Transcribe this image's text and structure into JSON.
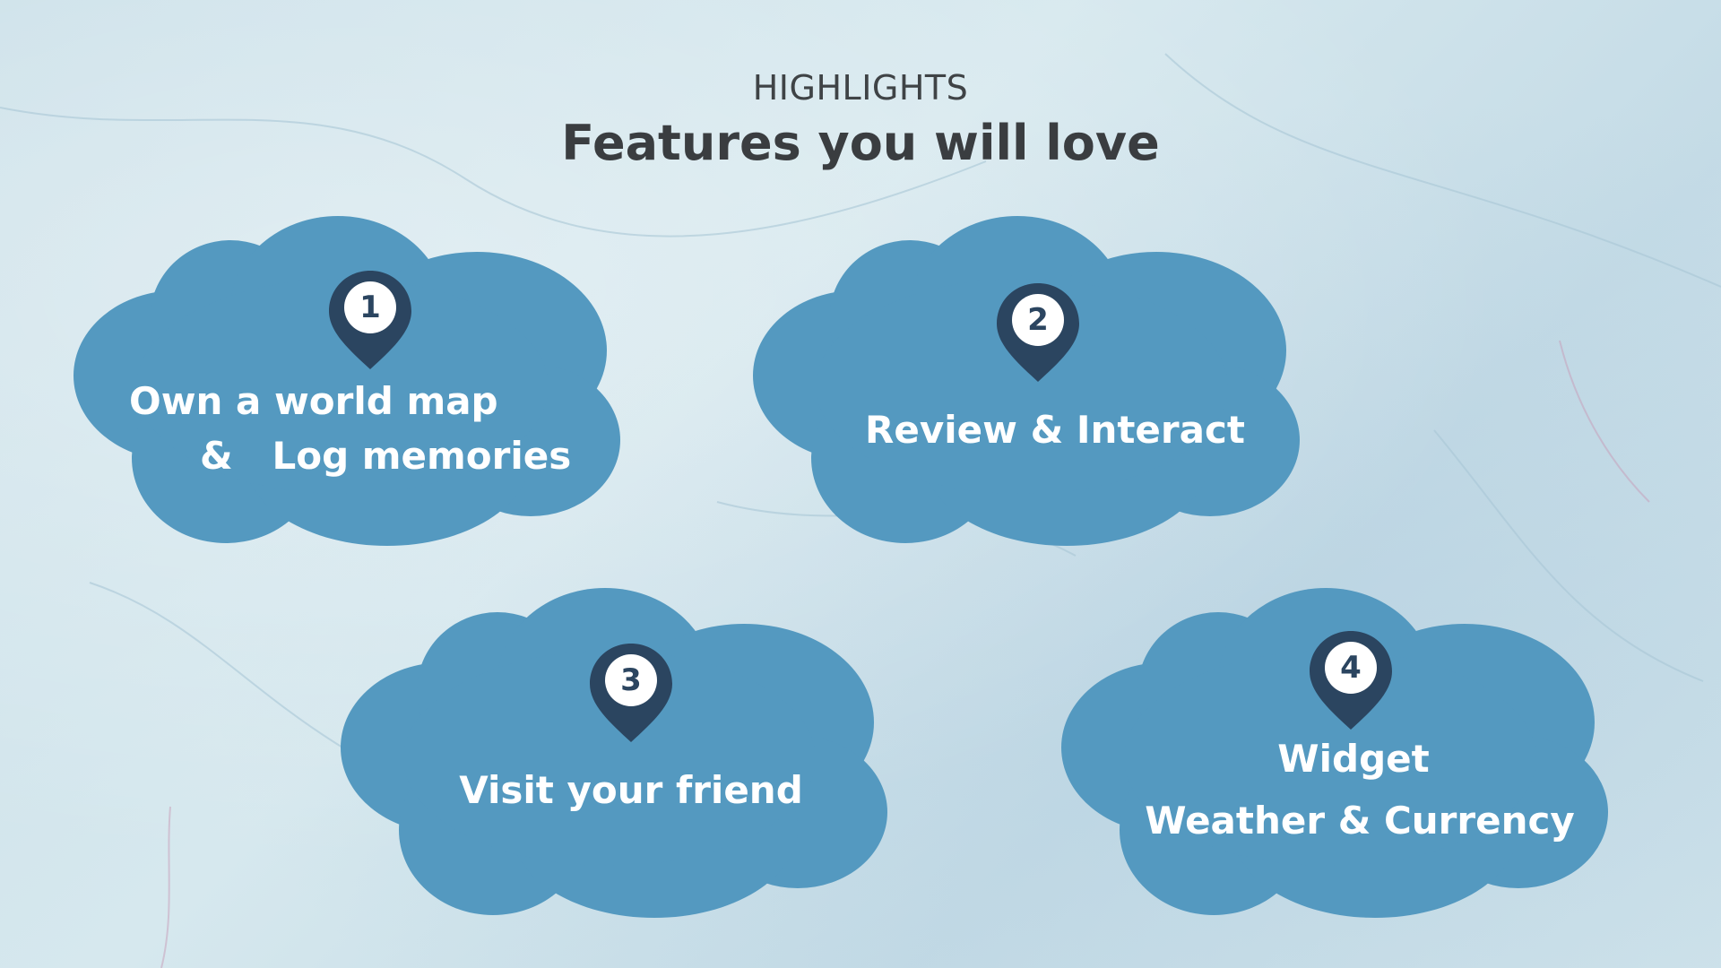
{
  "header": {
    "eyebrow": "HIGHLIGHTS",
    "title": "Features you will love"
  },
  "colors": {
    "cloud": "#5499c0",
    "pin": "#2b4560",
    "text": "#ffffff"
  },
  "features": [
    {
      "number": "1",
      "line1": "Own a world map",
      "line2": "&   Log memories"
    },
    {
      "number": "2",
      "line1": "Review & Interact"
    },
    {
      "number": "3",
      "line1": "Visit your friend"
    },
    {
      "number": "4",
      "line1": "Widget",
      "line2": "Weather & Currency"
    }
  ]
}
